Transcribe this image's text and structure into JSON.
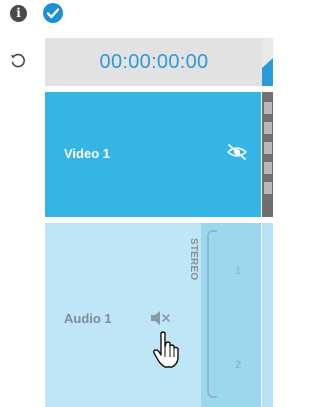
{
  "toolbar": {
    "info_icon": "info-icon",
    "check_icon": "checkmark-icon",
    "reset_icon": "reset-icon"
  },
  "timecode": "00:00:00:00",
  "tracks": {
    "video": {
      "label": "Video 1",
      "visibility_icon": "eye-slash-icon"
    },
    "audio": {
      "label": "Audio 1",
      "mute_icon": "speaker-mute-icon",
      "channel_mode": "STEREO",
      "channels": [
        "1",
        "2"
      ]
    }
  },
  "colors": {
    "accent": "#2f9ad8",
    "video_track": "#34b5e3",
    "audio_track": "#bfe6f6",
    "audio_channels": "#9bd8ef"
  }
}
